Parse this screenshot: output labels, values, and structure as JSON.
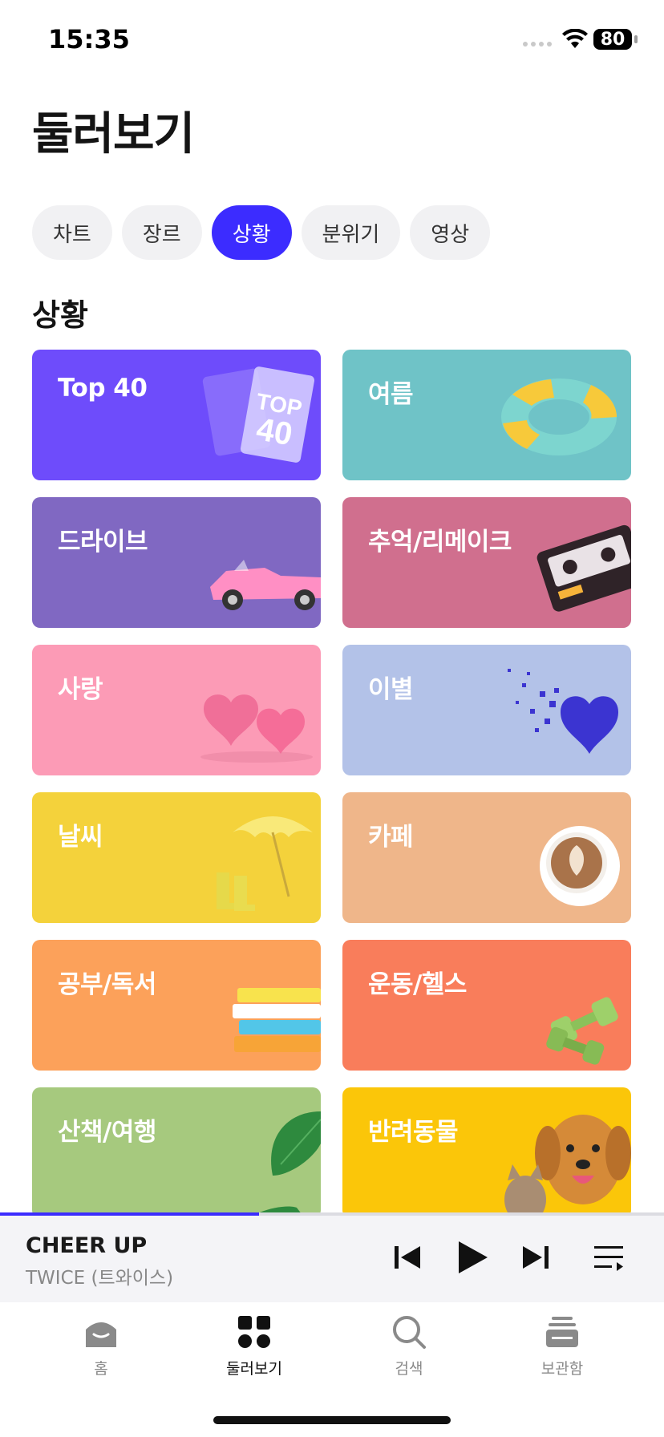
{
  "status_bar": {
    "time": "15:35",
    "battery": "80"
  },
  "page_title": "둘러보기",
  "tabs": [
    {
      "label": "차트",
      "active": false
    },
    {
      "label": "장르",
      "active": false
    },
    {
      "label": "상황",
      "active": true
    },
    {
      "label": "분위기",
      "active": false
    },
    {
      "label": "영상",
      "active": false
    }
  ],
  "section_title": "상황",
  "cards": [
    {
      "label": "Top 40",
      "color": "#6e4cfb",
      "art": "top40-badge-icon"
    },
    {
      "label": "여름",
      "color": "#6fc3c7",
      "art": "swim-ring-icon"
    },
    {
      "label": "드라이브",
      "color": "#8068c2",
      "art": "convertible-car-icon"
    },
    {
      "label": "추억/리메이크",
      "color": "#d06f8e",
      "art": "cassette-tape-icon"
    },
    {
      "label": "사랑",
      "color": "#fc9bb6",
      "art": "two-hearts-icon"
    },
    {
      "label": "이별",
      "color": "#b3c2e8",
      "art": "shattering-heart-icon"
    },
    {
      "label": "날씨",
      "color": "#f4d23b",
      "art": "umbrella-boots-icon"
    },
    {
      "label": "카페",
      "color": "#efb68a",
      "art": "latte-cup-icon"
    },
    {
      "label": "공부/독서",
      "color": "#fca15a",
      "art": "book-stack-icon"
    },
    {
      "label": "운동/헬스",
      "color": "#f97d5b",
      "art": "dumbbells-icon"
    },
    {
      "label": "산책/여행",
      "color": "#a6c97e",
      "art": "monstera-leaf-icon"
    },
    {
      "label": "반려동물",
      "color": "#fbc609",
      "art": "dog-cat-icon"
    }
  ],
  "player": {
    "title": "CHEER UP",
    "artist": "TWICE (트와이스)",
    "progress": 0.39
  },
  "nav": [
    {
      "label": "홈",
      "icon": "home-icon",
      "active": false
    },
    {
      "label": "둘러보기",
      "icon": "browse-grid-icon",
      "active": true
    },
    {
      "label": "검색",
      "icon": "search-icon",
      "active": false
    },
    {
      "label": "보관함",
      "icon": "library-icon",
      "active": false
    }
  ],
  "colors": {
    "accent": "#3c2cff",
    "tab_bg": "#f1f1f3",
    "player_bg": "#f4f4f7"
  }
}
